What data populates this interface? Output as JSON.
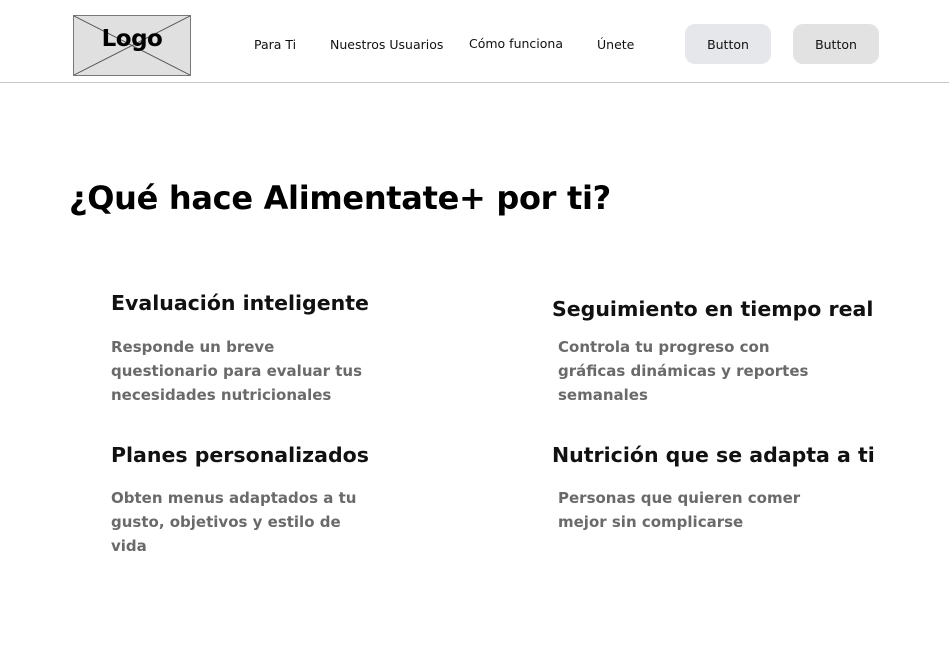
{
  "header": {
    "logo_text": "Logo",
    "nav": [
      {
        "label": "Para Ti"
      },
      {
        "label": "Nuestros Usuarios"
      },
      {
        "label": "Cómo funciona"
      },
      {
        "label": "Únete"
      }
    ],
    "buttons": [
      {
        "label": "Button"
      },
      {
        "label": "Button"
      }
    ]
  },
  "main": {
    "headline": "¿Qué hace Alimentate+ por ti?",
    "features": [
      {
        "title": "Evaluación inteligente",
        "description": "Responde un breve\nquestionario  para evaluar tus\nnecesidades nutricionales"
      },
      {
        "title": "Seguimiento en tiempo real",
        "description": "Controla tu progreso con\ngráficas dinámicas y reportes\nsemanales"
      },
      {
        "title": "Planes personalizados",
        "description": "Obten menus adaptados a tu\ngusto, objetivos y estilo de\nvida"
      },
      {
        "title": "Nutrición que se adapta a ti",
        "description": "Personas que quieren comer\nmejor sin complicarse"
      }
    ]
  },
  "colors": {
    "button_1_bg": "#e6e7eb",
    "button_2_bg": "#e2e2e2",
    "description_text": "#6a6a6a",
    "logo_placeholder_bg": "#e0e0e0"
  }
}
